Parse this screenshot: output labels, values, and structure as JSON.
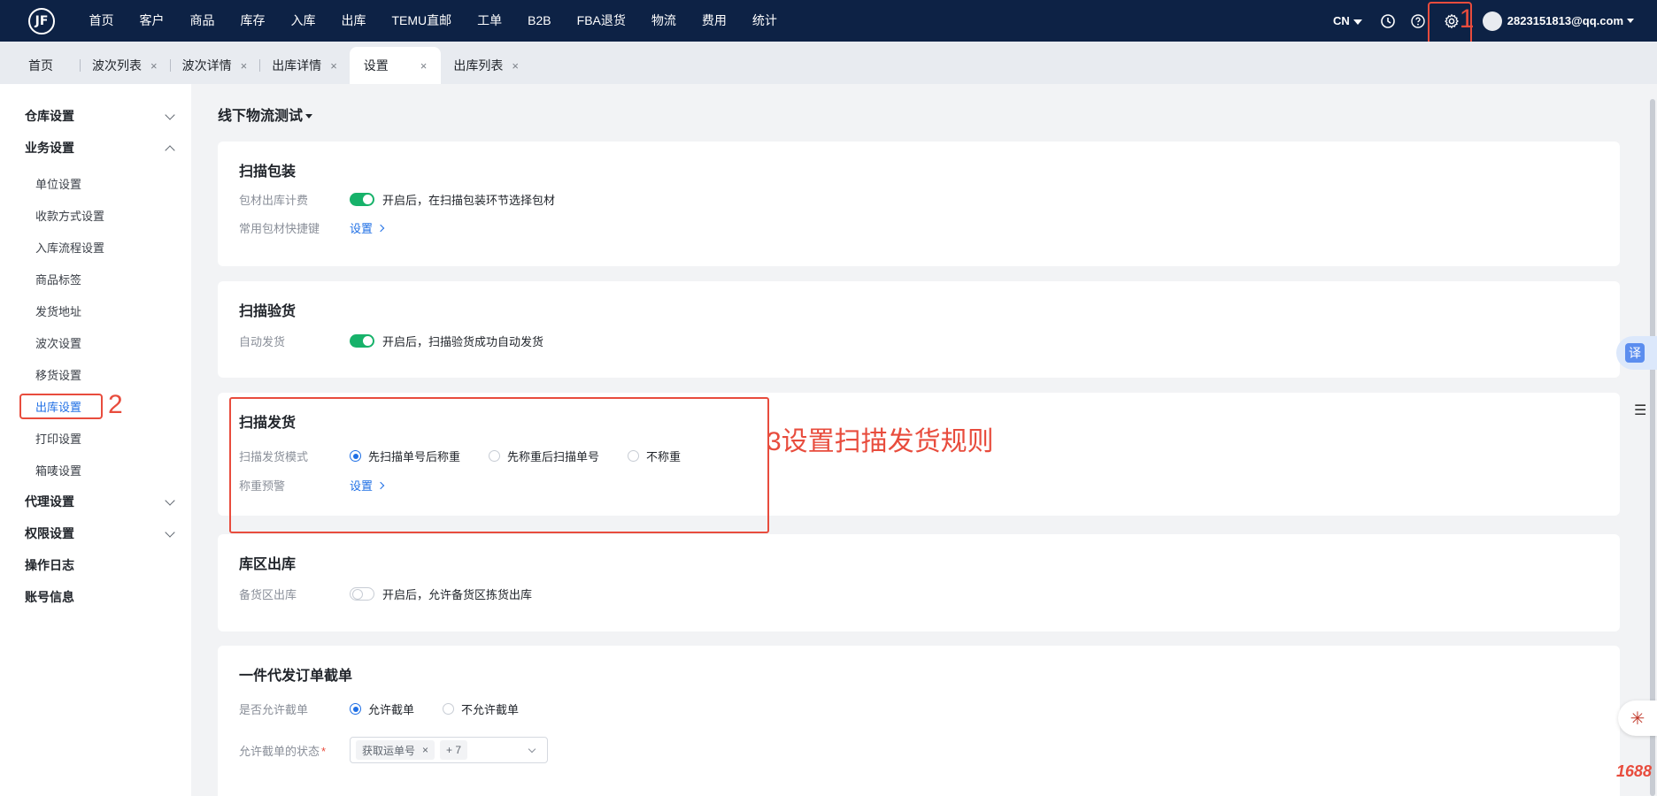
{
  "logo_text": "JF",
  "nav": [
    "首页",
    "客户",
    "商品",
    "库存",
    "入库",
    "出库",
    "TEMU直邮",
    "工单",
    "B2B",
    "FBA退货",
    "物流",
    "费用",
    "统计"
  ],
  "header": {
    "lang": "CN",
    "user": "2823151813@qq.com",
    "annotation_1": "1"
  },
  "tabs": [
    {
      "label": "首页",
      "closable": false
    },
    {
      "label": "波次列表",
      "closable": true
    },
    {
      "label": "波次详情",
      "closable": true
    },
    {
      "label": "出库详情",
      "closable": true
    },
    {
      "label": "设置",
      "closable": true,
      "active": true
    },
    {
      "label": "出库列表",
      "closable": true
    }
  ],
  "close_glyph": "×",
  "sidebar": {
    "warehouse": "仓库设置",
    "business": "业务设置",
    "subs": [
      "单位设置",
      "收款方式设置",
      "入库流程设置",
      "商品标签",
      "发货地址",
      "波次设置",
      "移货设置",
      "出库设置",
      "打印设置",
      "箱唛设置"
    ],
    "agent": "代理设置",
    "permission": "权限设置",
    "oplog": "操作日志",
    "account": "账号信息",
    "annotation_2": "2"
  },
  "main": {
    "page_title": "线下物流测试",
    "scan_pack": {
      "title": "扫描包装",
      "row1_label": "包材出库计费",
      "row1_desc": "开启后，在扫描包装环节选择包材",
      "row1_on": true,
      "row2_label": "常用包材快捷键",
      "row2_link": "设置"
    },
    "scan_inspect": {
      "title": "扫描验货",
      "row1_label": "自动发货",
      "row1_desc": "开启后，扫描验货成功自动发货",
      "row1_on": true
    },
    "scan_ship": {
      "title": "扫描发货",
      "mode_label": "扫描发货模式",
      "options": [
        "先扫描单号后称重",
        "先称重后扫描单号",
        "不称重"
      ],
      "selected": "先扫描单号后称重",
      "weight_label": "称重预警",
      "weight_link": "设置",
      "annotation_3": "3设置扫描发货规则"
    },
    "zone_out": {
      "title": "库区出库",
      "row1_label": "备货区出库",
      "row1_desc": "开启后，允许备货区拣货出库",
      "row1_on": false
    },
    "dropship": {
      "title": "一件代发订单截单",
      "allow_label": "是否允许截单",
      "options": [
        "允许截单",
        "不允许截单"
      ],
      "selected": "允许截单",
      "status_label": "允许截单的状态",
      "required_mark": "*",
      "tag": "获取运单号",
      "more": "+ 7"
    }
  },
  "floats": {
    "translate": "译",
    "search": "☰",
    "ai": "✳",
    "brand": "1688"
  },
  "colors": {
    "topbar": "#0d2245",
    "accent": "#1f6fe5",
    "toggle_on": "#17b26a",
    "annotation": "#e84c3d"
  }
}
